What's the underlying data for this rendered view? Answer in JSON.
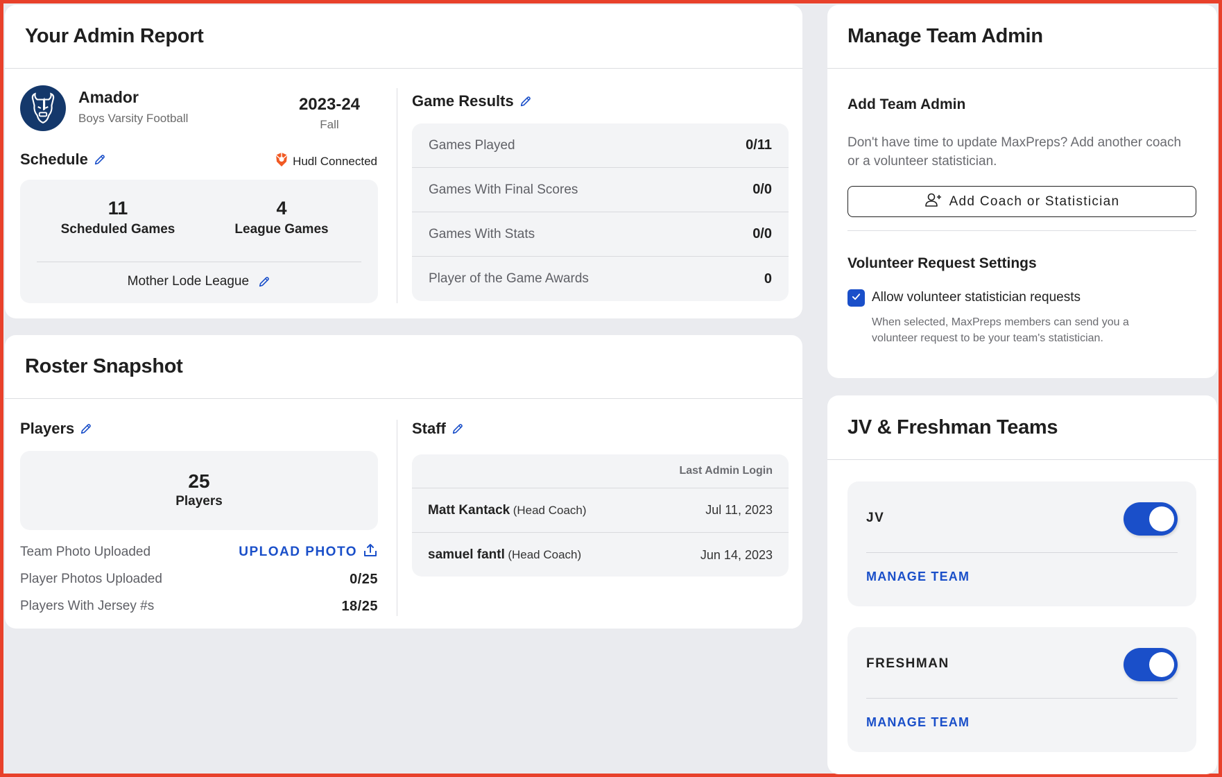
{
  "admin_report": {
    "title": "Your Admin Report",
    "team": {
      "name": "Amador",
      "sport": "Boys Varsity Football",
      "logo_icon": "bison-logo-icon",
      "season_year": "2023-24",
      "season_term": "Fall"
    },
    "schedule": {
      "title": "Schedule",
      "hudl_status": "Hudl Connected",
      "scheduled_games": "11",
      "scheduled_games_label": "Scheduled Games",
      "league_games": "4",
      "league_games_label": "League Games",
      "league_name": "Mother Lode League"
    },
    "game_results": {
      "title": "Game Results",
      "rows": [
        {
          "label": "Games Played",
          "value": "0/11"
        },
        {
          "label": "Games With Final Scores",
          "value": "0/0"
        },
        {
          "label": "Games With Stats",
          "value": "0/0"
        },
        {
          "label": "Player of the Game Awards",
          "value": "0"
        }
      ]
    }
  },
  "roster_snapshot": {
    "title": "Roster Snapshot",
    "players": {
      "title": "Players",
      "count": "25",
      "count_label": "Players",
      "team_photo_label": "Team Photo Uploaded",
      "upload_photo_label": "UPLOAD PHOTO",
      "player_photos_label": "Player Photos Uploaded",
      "player_photos_value": "0/25",
      "jersey_label": "Players With Jersey #s",
      "jersey_value": "18/25"
    },
    "staff": {
      "title": "Staff",
      "column_header": "Last Admin Login",
      "members": [
        {
          "name": "Matt Kantack",
          "role": "(Head Coach)",
          "last_login": "Jul 11, 2023"
        },
        {
          "name": "samuel fantl",
          "role": "(Head Coach)",
          "last_login": "Jun 14, 2023"
        }
      ]
    }
  },
  "manage_team_admin": {
    "title": "Manage Team Admin",
    "add_title": "Add Team Admin",
    "add_description": "Don't have time to update MaxPreps? Add another coach or a volunteer statistician.",
    "add_button_label": "Add Coach or Statistician",
    "volunteer_title": "Volunteer Request Settings",
    "volunteer_checkbox_label": "Allow volunteer statistician requests",
    "volunteer_checkbox_checked": true,
    "volunteer_help": "When selected, MaxPreps members can send you a volunteer request to be your team's statistician."
  },
  "jv_freshman": {
    "title": "JV & Freshman Teams",
    "teams": [
      {
        "name": "JV",
        "enabled": true,
        "manage_label": "MANAGE TEAM"
      },
      {
        "name": "FRESHMAN",
        "enabled": true,
        "manage_label": "MANAGE TEAM"
      }
    ]
  },
  "colors": {
    "accent": "#1a4fc9",
    "page_background": "#eaebef",
    "panel_background": "#f3f4f6",
    "hudl_orange": "#f15a24",
    "frame_border": "#e8412b",
    "logo_navy": "#14386b"
  }
}
